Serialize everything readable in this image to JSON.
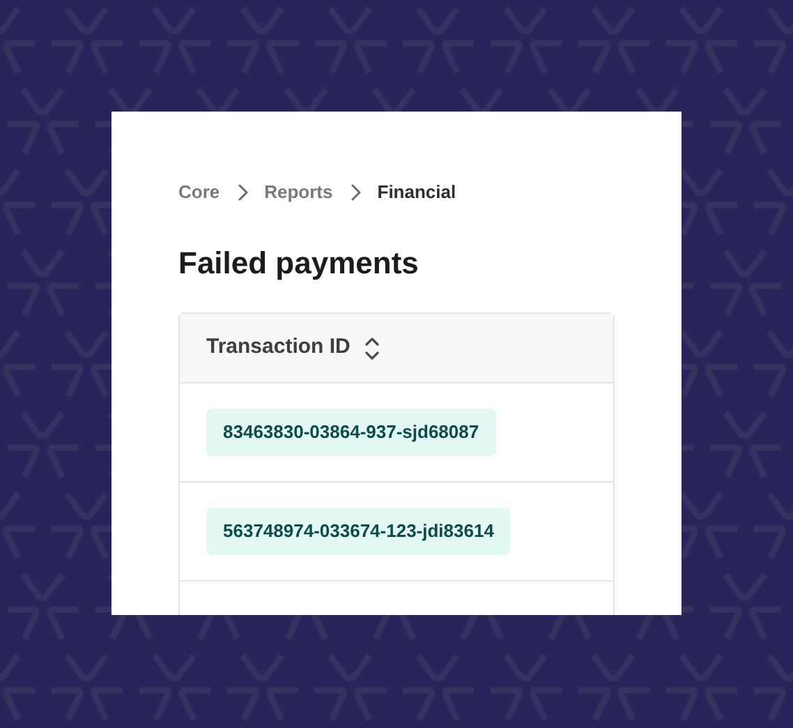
{
  "breadcrumb": [
    {
      "label": "Core",
      "selected": false
    },
    {
      "label": "Reports",
      "selected": false
    },
    {
      "label": "Financial",
      "selected": true
    }
  ],
  "title": "Failed payments",
  "table": {
    "columns": [
      {
        "label": "Transaction ID",
        "sortable": true
      }
    ],
    "rows": [
      {
        "transaction_id": "83463830-03864-937-sjd68087"
      },
      {
        "transaction_id": "563748974-033674-123-jdi83614"
      }
    ]
  }
}
